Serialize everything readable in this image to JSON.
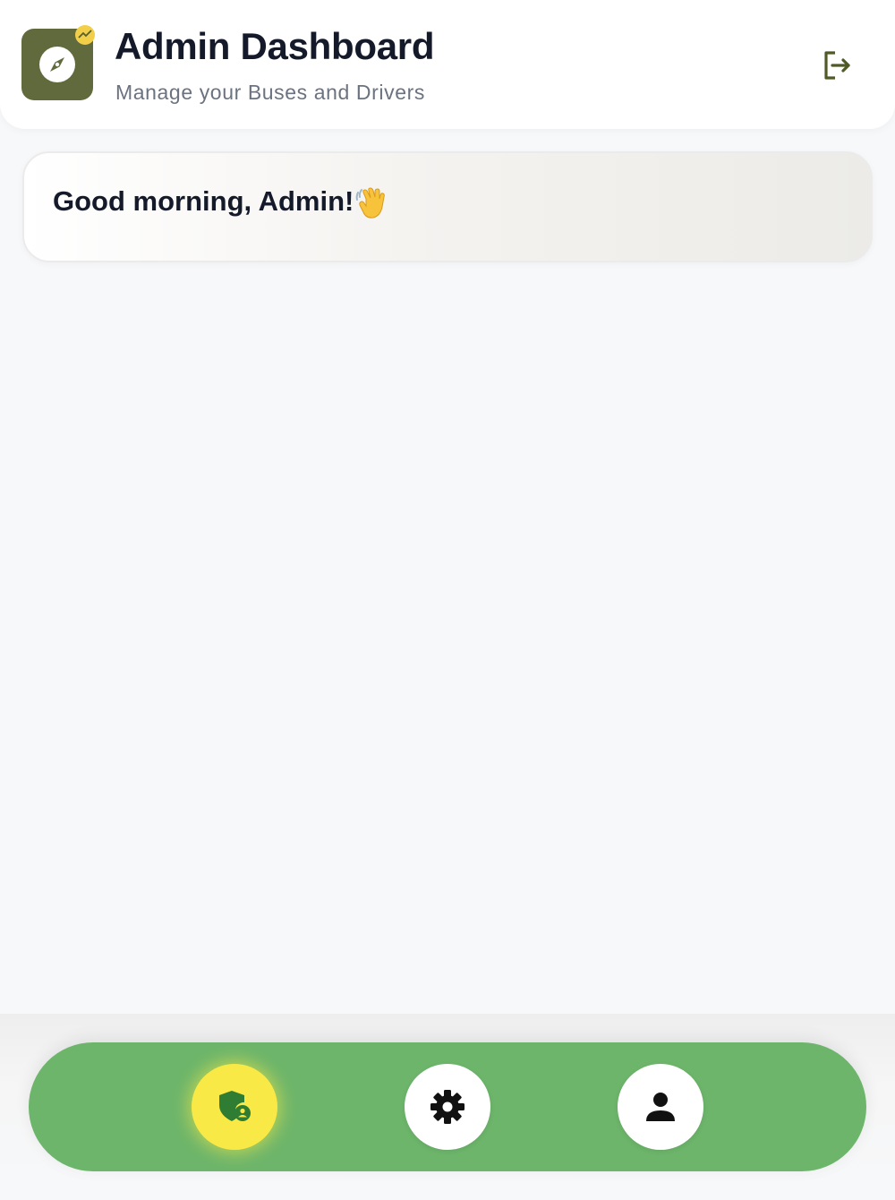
{
  "header": {
    "title": "Admin Dashboard",
    "subtitle": "Manage your Buses and Drivers",
    "logo_icon": "compass-icon",
    "logo_badge_icon": "trending-up-icon",
    "logout_icon": "logout-icon"
  },
  "greeting": {
    "text": "Good morning, Admin!",
    "emoji_icon": "waving-hand-icon"
  },
  "bottom_nav": {
    "items": [
      {
        "icon": "admin-shield-icon",
        "active": true
      },
      {
        "icon": "gear-icon",
        "active": false
      },
      {
        "icon": "person-icon",
        "active": false
      }
    ]
  },
  "colors": {
    "logo_bg": "#606a3c",
    "badge": "#f2cf48",
    "nav_bg": "#6db56b",
    "nav_active": "#f9e946",
    "shield_green": "#2e7d32",
    "text_dark": "#151a2b",
    "text_muted": "#6b7280"
  }
}
